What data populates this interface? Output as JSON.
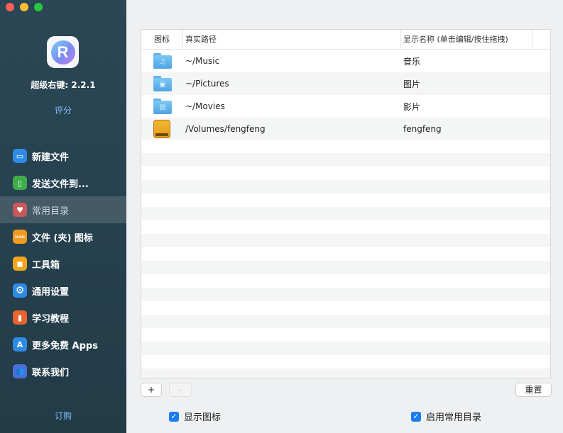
{
  "app": {
    "logo_letter": "R",
    "version": "超级右键: 2.2.1",
    "rate": "评分",
    "subscribe": "订购"
  },
  "sidebar": {
    "items": [
      {
        "label": "新建文件",
        "icon": "new-file-icon",
        "glyph": "▭",
        "color": "#2d8be6"
      },
      {
        "label": "发送文件到...",
        "icon": "send-file-icon",
        "glyph": "▯",
        "color": "#3fae4a"
      },
      {
        "label": "常用目录",
        "icon": "heart-icon",
        "glyph": "♥",
        "color": "#c9585a",
        "active": true
      },
      {
        "label": "文件 (夹) 图标",
        "icon": "icon-badge-icon",
        "glyph": "icon",
        "color": "#f29a1f"
      },
      {
        "label": "工具箱",
        "icon": "toolbox-icon",
        "glyph": "◼",
        "color": "#f2a41f"
      },
      {
        "label": "通用设置",
        "icon": "gear-icon",
        "glyph": "⚙",
        "color": "#2d8be6"
      },
      {
        "label": "学习教程",
        "icon": "book-icon",
        "glyph": "▮",
        "color": "#e9642f"
      },
      {
        "label": "更多免费 Apps",
        "icon": "app-store-icon",
        "glyph": "A",
        "color": "#2d8be6"
      },
      {
        "label": "联系我们",
        "icon": "contacts-icon",
        "glyph": "👥",
        "color": "#4a6fd8"
      }
    ]
  },
  "table": {
    "columns": {
      "icon": "图标",
      "path": "真实路径",
      "name": "显示名称 (单击编辑/按住拖拽)"
    },
    "rows": [
      {
        "icon": "music-folder-icon",
        "glyph": "♫",
        "path": "~/Music",
        "name": "音乐"
      },
      {
        "icon": "pictures-folder-icon",
        "glyph": "▣",
        "path": "~/Pictures",
        "name": "图片"
      },
      {
        "icon": "movies-folder-icon",
        "glyph": "▤",
        "path": "~/Movies",
        "name": "影片"
      },
      {
        "icon": "external-drive-icon",
        "glyph": "",
        "path": "/Volumes/fengfeng",
        "name": "fengfeng"
      }
    ]
  },
  "buttons": {
    "add": "+",
    "remove": "-",
    "reset": "重置"
  },
  "options": {
    "show_icons": {
      "label": "显示图标",
      "checked": true
    },
    "enable_favorites": {
      "label": "启用常用目录",
      "checked": true
    }
  },
  "colors": {
    "accent": "#1a7df0",
    "link": "#7fc0ff",
    "sidebar_bg": "#274250"
  }
}
